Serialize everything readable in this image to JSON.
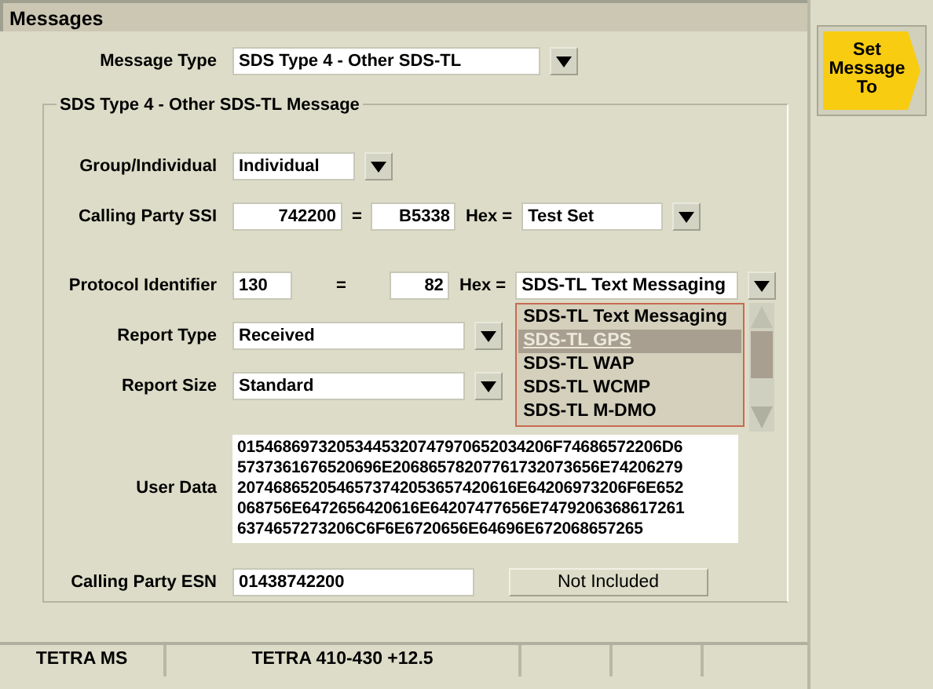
{
  "title": "Messages",
  "message_type": {
    "label": "Message Type",
    "value": "SDS Type 4 - Other SDS-TL"
  },
  "group_title": "SDS Type 4 - Other SDS-TL Message",
  "group_individual": {
    "label": "Group/Individual",
    "value": "Individual"
  },
  "calling_party_ssi": {
    "label": "Calling Party SSI",
    "decimal": "742200",
    "equals": "=",
    "hex": "B5338",
    "hex_label": "Hex =",
    "source": "Test Set"
  },
  "protocol_identifier": {
    "label": "Protocol Identifier",
    "decimal": "130",
    "equals": "=",
    "hex": "82",
    "hex_label": "Hex =",
    "value": "SDS-TL Text Messaging"
  },
  "protocol_menu": [
    {
      "label": "SDS-TL Text Messaging",
      "selected": false
    },
    {
      "label": "SDS-TL GPS",
      "selected": true
    },
    {
      "label": "SDS-TL WAP",
      "selected": false
    },
    {
      "label": "SDS-TL WCMP",
      "selected": false
    },
    {
      "label": "SDS-TL M-DMO",
      "selected": false
    }
  ],
  "report_type": {
    "label": "Report Type",
    "value": "Received"
  },
  "report_size": {
    "label": "Report Size",
    "value": "Standard"
  },
  "user_data": {
    "label": "User Data",
    "lines": [
      "01546869732053445320747970652034206F74686572206D6",
      "5737361676520696E20686578207761732073656E74206279",
      "2074686520546573742053657420616E64206973206F6E652",
      "068756E6472656420616E64207477656E7479206368617261",
      "6374657273206C6F6E6720656E64696E672068657265"
    ]
  },
  "calling_party_esn": {
    "label": "Calling Party ESN",
    "value": "01438742200",
    "button": "Not Included"
  },
  "side_button": "Set Message To",
  "status_bar": [
    "TETRA MS",
    "TETRA 410-430 +12.5"
  ]
}
